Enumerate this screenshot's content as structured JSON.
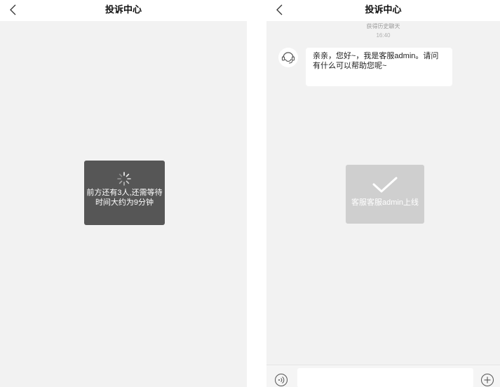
{
  "left": {
    "title": "投诉中心",
    "back_icon": "chevron-left-icon",
    "loading": {
      "text": "前方还有3人,还需等待时间大约为9分钟",
      "icon": "spinner-icon"
    }
  },
  "right": {
    "title": "投诉中心",
    "back_icon": "chevron-left-icon",
    "history_label": "获得历史聊天",
    "timestamp": "16:40",
    "agent_avatar_icon": "headset-icon",
    "message": "亲亲，您好~，我是客服admin。请问有什么可以帮助您呢~",
    "online_toast": {
      "text": "客服客服admin上线",
      "icon": "checkmark-icon"
    },
    "input": {
      "value": "",
      "placeholder": ""
    },
    "voice_icon": "voice-icon",
    "plus_icon": "plus-icon"
  },
  "colors": {
    "background": "#f2f2f2",
    "toast_dark": "#565656",
    "toast_light": "#cfcfcf",
    "bubble": "#ffffff"
  }
}
